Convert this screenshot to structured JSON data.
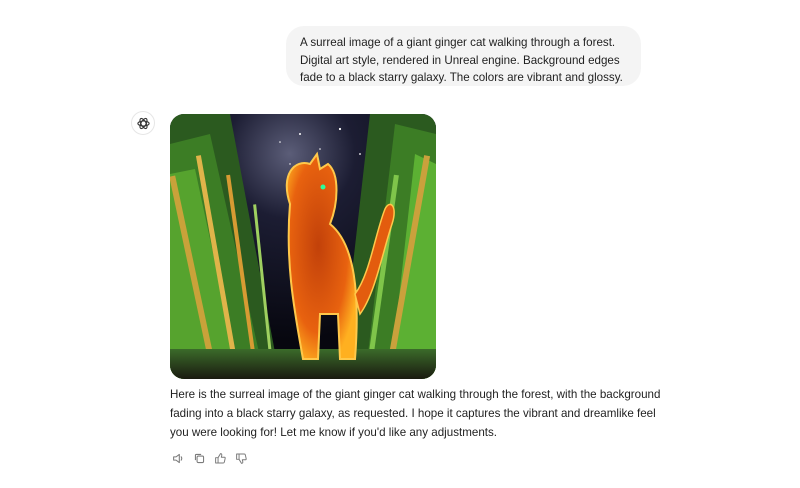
{
  "conversation": {
    "user_message": "A surreal image of a giant ginger cat walking through a forest. Digital art style, rendered in Unreal engine. Background edges fade to a black starry galaxy. The colors are vibrant and glossy.",
    "assistant_icon": "openai-logo-icon",
    "generated_image_icon": "generated-image",
    "assistant_reply": "Here is the surreal image of the giant ginger cat walking through the forest, with the background fading into a black starry galaxy, as requested. I hope it captures the vibrant and dreamlike feel you were looking for! Let me know if you'd like any adjustments.",
    "actions": [
      {
        "icon": "read-aloud-icon"
      },
      {
        "icon": "copy-icon"
      },
      {
        "icon": "thumbs-up-icon"
      },
      {
        "icon": "thumbs-down-icon"
      }
    ]
  },
  "colors": {
    "user_bubble_bg": "#f4f4f4",
    "text": "#1f1f1f",
    "icon": "#7a7a7a"
  }
}
